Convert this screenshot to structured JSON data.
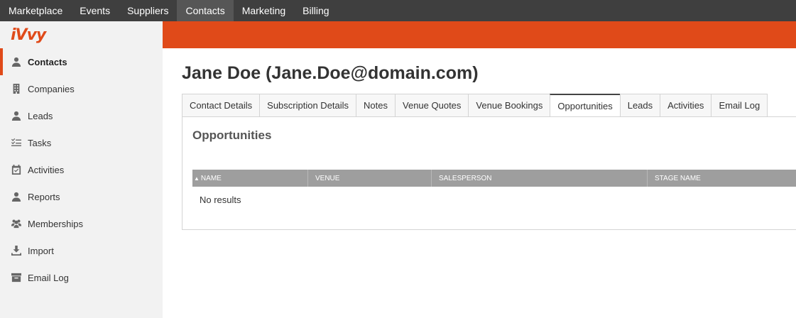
{
  "topnav": {
    "items": [
      {
        "label": "Marketplace"
      },
      {
        "label": "Events"
      },
      {
        "label": "Suppliers"
      },
      {
        "label": "Contacts",
        "active": true
      },
      {
        "label": "Marketing"
      },
      {
        "label": "Billing"
      }
    ]
  },
  "brand": {
    "logo_text": "iVvy",
    "accent_color": "#e04a19"
  },
  "sidebar": {
    "items": [
      {
        "label": "Contacts",
        "icon": "user-icon",
        "active": true
      },
      {
        "label": "Companies",
        "icon": "building-icon"
      },
      {
        "label": "Leads",
        "icon": "user-icon"
      },
      {
        "label": "Tasks",
        "icon": "tasks-icon"
      },
      {
        "label": "Activities",
        "icon": "calendar-check-icon"
      },
      {
        "label": "Reports",
        "icon": "user-icon"
      },
      {
        "label": "Memberships",
        "icon": "users-icon"
      },
      {
        "label": "Import",
        "icon": "download-icon"
      },
      {
        "label": "Email Log",
        "icon": "archive-icon"
      }
    ]
  },
  "main": {
    "title": "Jane Doe (Jane.Doe@domain.com)",
    "tabs": [
      {
        "label": "Contact Details"
      },
      {
        "label": "Subscription Details"
      },
      {
        "label": "Notes"
      },
      {
        "label": "Venue Quotes"
      },
      {
        "label": "Venue Bookings"
      },
      {
        "label": "Opportunities",
        "active": true
      },
      {
        "label": "Leads"
      },
      {
        "label": "Activities"
      },
      {
        "label": "Email Log"
      }
    ],
    "panel": {
      "title": "Opportunities",
      "columns": [
        "NAME",
        "VENUE",
        "SALESPERSON",
        "STAGE NAME"
      ],
      "empty_text": "No results"
    }
  }
}
